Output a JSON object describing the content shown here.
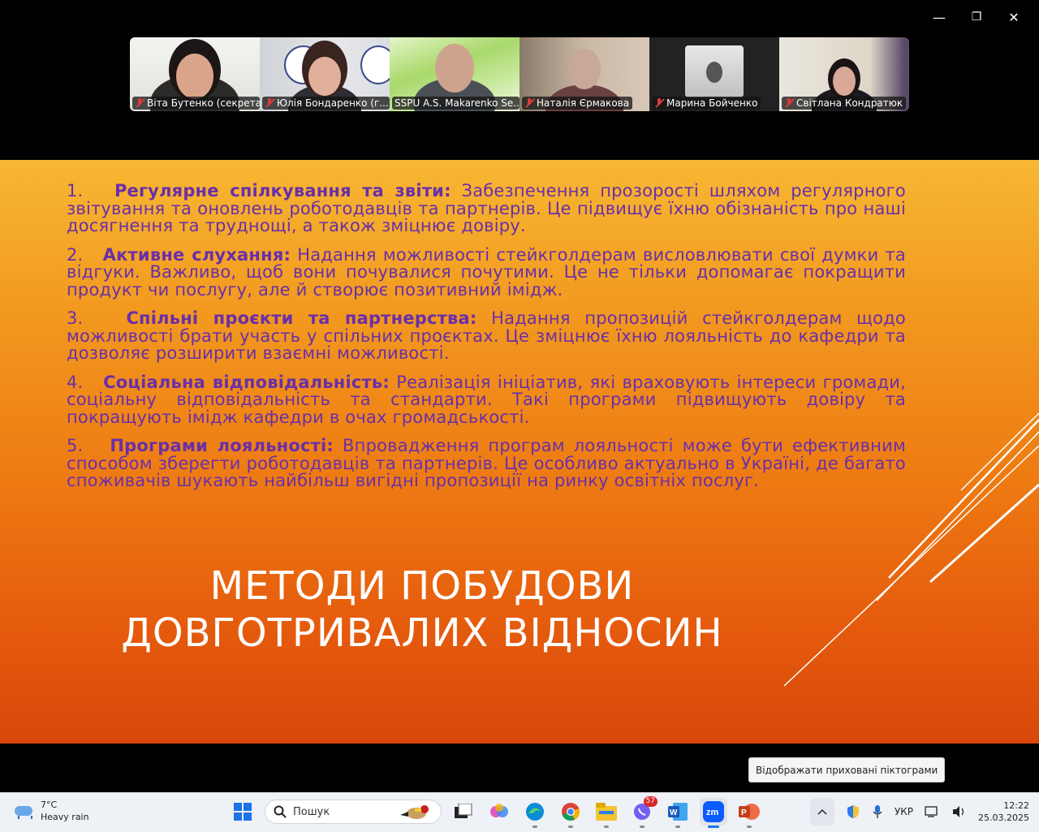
{
  "window": {
    "minimize_icon": "—",
    "restore_icon": "❐",
    "close_icon": "✕"
  },
  "participants": [
    {
      "name": "Віта Бутенко (секрета...",
      "muted": true
    },
    {
      "name": "Юлія Бондаренко (г...",
      "muted": true
    },
    {
      "name": "SSPU A.S. Makarenko Se...",
      "muted": false,
      "active_speaker": true
    },
    {
      "name": "Наталія  Єрмакова",
      "muted": true
    },
    {
      "name": "Марина Бойченко",
      "muted": true
    },
    {
      "name": "Світлана Кондратюк",
      "muted": true
    }
  ],
  "slide": {
    "items": [
      {
        "num": "1.",
        "head": "Регулярне спілкування та звіти:",
        "body": "Забезпечення прозорості шляхом регулярного звітування та оновлень роботодавців та партнерів. Це підвищує їхню обізнаність про наші досягнення та труднощі, а також зміцнює довіру."
      },
      {
        "num": "2.",
        "head": "Активне слухання:",
        "body": "Надання можливості стейкголдерам висловлювати свої думки та відгуки. Важливо, щоб вони почувалися почутими. Це не тільки допомагає покращити продукт чи послугу, але й створює позитивний імідж."
      },
      {
        "num": "3.",
        "head": "Спільні проєкти та партнерства:",
        "body": "Надання пропозицій стейкголдерам щодо можливості брати участь у спільних проєктах. Це зміцнює їхню лояльність до кафедри та дозволяє розширити взаємні можливості."
      },
      {
        "num": "4.",
        "head": "Соціальна відповідальність:",
        "body": "Реалізація ініціатив, які враховують інтереси громади, соціальну відповідальність та стандарти. Такі програми підвищують довіру та покращують імідж кафедри в очах громадськості."
      },
      {
        "num": "5.",
        "head": "Програми лояльності:",
        "body": "Впровадження програм лояльності може бути ефективним способом зберегти роботодавців та партнерів. Це особливо актуально в Україні, де багато споживачів шукають найбільш вигідні пропозиції на ринку освітніх послуг."
      }
    ],
    "title_line1": "МЕТОДИ ПОБУДОВИ",
    "title_line2": "ДОВГОТРИВАЛИХ ВІДНОСИН",
    "colors": {
      "text": "#6a2fa8",
      "title": "#ffffff",
      "top": "#f7b733",
      "bottom": "#d8480a"
    }
  },
  "tooltip": "Відображати приховані піктограми",
  "taskbar": {
    "weather_temp": "7°C",
    "weather_desc": "Heavy rain",
    "search_placeholder": "Пошук",
    "viber_badge": "57",
    "language": "УКР",
    "time": "12:22",
    "date": "25.03.2025"
  }
}
